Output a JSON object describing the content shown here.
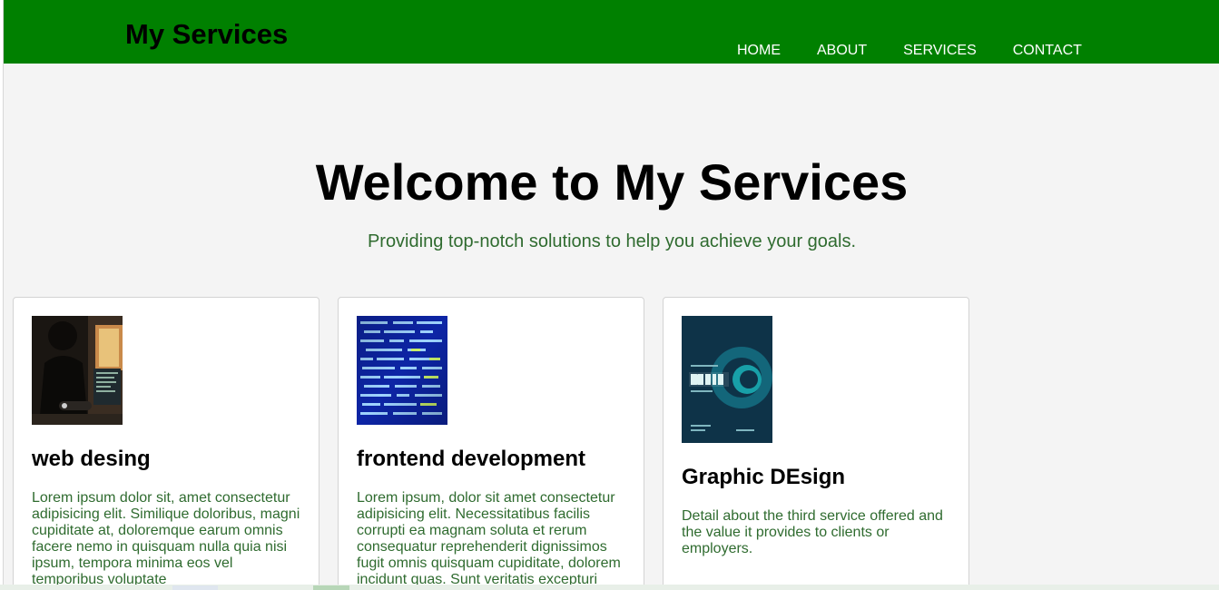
{
  "header": {
    "brand": "My Services",
    "nav": [
      "HOME",
      "ABOUT",
      "SERVICES",
      "CONTACT"
    ]
  },
  "hero": {
    "title": "Welcome to My Services",
    "subtitle": "Providing top-notch solutions to help you achieve your goals."
  },
  "cards": [
    {
      "title": "web desing",
      "text": "Lorem ipsum dolor sit, amet consectetur adipisicing elit. Similique doloribus, magni cupiditate at, doloremque earum omnis facere nemo in quisquam nulla quia nisi ipsum, tempora minima eos vel temporibus voluptate",
      "image": "web-design-photo"
    },
    {
      "title": "frontend development",
      "text": "Lorem ipsum, dolor sit amet consectetur adipisicing elit. Necessitatibus facilis corrupti ea magnam soluta et rerum consequatur reprehenderit dignissimos fugit omnis quisquam cupiditate, dolorem incidunt quas. Sunt veritatis excepturi",
      "image": "code-screen-photo"
    },
    {
      "title": "Graphic DEsign",
      "text": "Detail about the third service offered and the value it provides to clients or employers.",
      "image": "design-poster"
    }
  ],
  "colors": {
    "header": "#008000",
    "background": "#f4f4f4",
    "subtitle_text": "#2f6b2f"
  }
}
